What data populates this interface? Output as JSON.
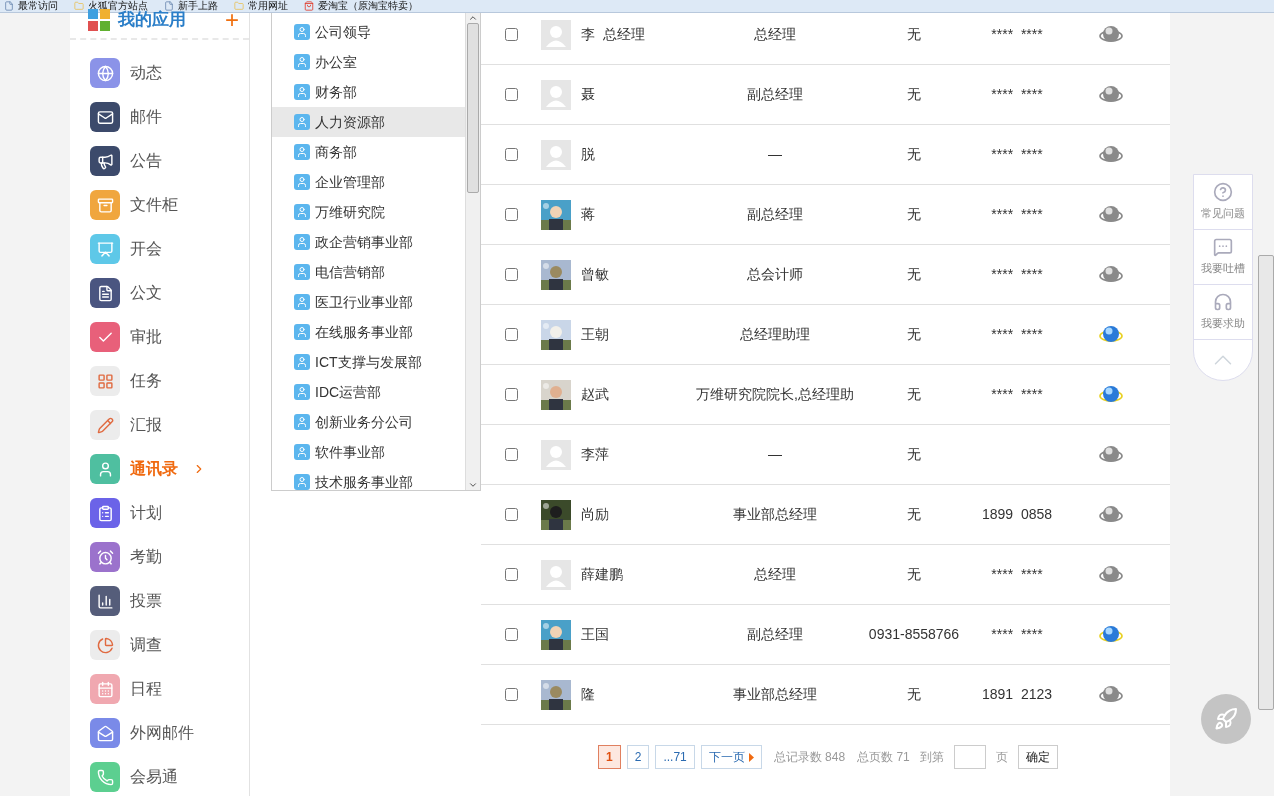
{
  "bookmarks": [
    {
      "label": "最常访问",
      "kind": "page"
    },
    {
      "label": "火狐官方站点",
      "kind": "folder"
    },
    {
      "label": "新手上路",
      "kind": "page"
    },
    {
      "label": "常用网址",
      "kind": "folder"
    },
    {
      "label": "爱淘宝（原淘宝特卖）",
      "kind": "shop"
    }
  ],
  "sidebar": {
    "title": "我的应用",
    "add": "+",
    "items": [
      {
        "label": "动态",
        "color": "#8b93e8",
        "selected": false
      },
      {
        "label": "邮件",
        "color": "#3c4a6b",
        "selected": false
      },
      {
        "label": "公告",
        "color": "#3c4a6b",
        "selected": false
      },
      {
        "label": "文件柜",
        "color": "#f0a63e",
        "selected": false
      },
      {
        "label": "开会",
        "color": "#5ec8e8",
        "selected": false
      },
      {
        "label": "公文",
        "color": "#4a5580",
        "selected": false
      },
      {
        "label": "审批",
        "color": "#e8607a",
        "selected": false
      },
      {
        "label": "任务",
        "color": "#ececec",
        "selected": false
      },
      {
        "label": "汇报",
        "color": "#ececec",
        "selected": false
      },
      {
        "label": "通讯录",
        "color": "#4fbfa0",
        "selected": true
      },
      {
        "label": "计划",
        "color": "#6b63e8",
        "selected": false
      },
      {
        "label": "考勤",
        "color": "#9b72cc",
        "selected": false
      },
      {
        "label": "投票",
        "color": "#555d7a",
        "selected": false
      },
      {
        "label": "调查",
        "color": "#ececec",
        "selected": false
      },
      {
        "label": "日程",
        "color": "#f0a8b0",
        "selected": false
      },
      {
        "label": "外网邮件",
        "color": "#7a8ae8",
        "selected": false
      },
      {
        "label": "会易通",
        "color": "#5ccf90",
        "selected": false
      }
    ]
  },
  "departments": [
    {
      "label": "公司领导",
      "selected": false
    },
    {
      "label": "办公室",
      "selected": false
    },
    {
      "label": "财务部",
      "selected": false
    },
    {
      "label": "人力资源部",
      "selected": true
    },
    {
      "label": "商务部",
      "selected": false
    },
    {
      "label": "企业管理部",
      "selected": false
    },
    {
      "label": "万维研究院",
      "selected": false
    },
    {
      "label": "政企营销事业部",
      "selected": false
    },
    {
      "label": "电信营销部",
      "selected": false
    },
    {
      "label": "医卫行业事业部",
      "selected": false
    },
    {
      "label": "在线服务事业部",
      "selected": false
    },
    {
      "label": "ICT支撑与发展部",
      "selected": false
    },
    {
      "label": "IDC运营部",
      "selected": false
    },
    {
      "label": "创新业务分公司",
      "selected": false
    },
    {
      "label": "软件事业部",
      "selected": false
    },
    {
      "label": "技术服务事业部",
      "selected": false
    }
  ],
  "contacts": [
    {
      "checked": false,
      "kind": "placeholder",
      "name": "李  总经理",
      "title": "总经理",
      "office_phone": "无",
      "mobile": "****  ****",
      "online": false
    },
    {
      "checked": false,
      "kind": "placeholder",
      "name": "聂",
      "title": "副总经理",
      "office_phone": "无",
      "mobile": "****  ****",
      "online": false
    },
    {
      "checked": false,
      "kind": "placeholder",
      "name": "脱",
      "title": "—",
      "office_phone": "无",
      "mobile": "****  ****",
      "online": false
    },
    {
      "checked": false,
      "name": "蒋",
      "title": "副总经理",
      "office_phone": "无",
      "mobile": "****  ****",
      "online": false
    },
    {
      "checked": false,
      "name": "曾敏",
      "title": "总会计师",
      "office_phone": "无",
      "mobile": "****  ****",
      "online": false
    },
    {
      "checked": false,
      "name": "王朝",
      "title": "总经理助理",
      "office_phone": "无",
      "mobile": "****  ****",
      "online": true
    },
    {
      "checked": false,
      "name": "赵武",
      "title": "万维研究院院长,总经理助",
      "office_phone": "无",
      "mobile": "****  ****",
      "online": true
    },
    {
      "checked": false,
      "kind": "placeholder",
      "name": "李萍",
      "title": "—",
      "office_phone": "无",
      "online": false
    },
    {
      "checked": false,
      "name": "尚励",
      "title": "事业部总经理",
      "office_phone": "无",
      "mobile": "1899  0858",
      "online": false
    },
    {
      "checked": false,
      "kind": "placeholder",
      "name": "薛建鹏",
      "title": "总经理",
      "office_phone": "无",
      "mobile": "****  ****",
      "online": false
    },
    {
      "checked": false,
      "name": "王国",
      "title": "副总经理",
      "office_phone": "0931-8558766",
      "mobile": "****  ****",
      "online": true
    },
    {
      "checked": false,
      "name": "隆",
      "title": "事业部总经理",
      "office_phone": "无",
      "mobile": "1891  2123",
      "online": false
    }
  ],
  "pagination": {
    "pages": [
      {
        "label": "1",
        "selected": true
      },
      {
        "label": "2",
        "selected": false
      },
      {
        "label": "...71",
        "selected": false
      }
    ],
    "next": "下一页",
    "total_records": "总记录数 848",
    "total_pages": "总页数 71",
    "goto": "到第",
    "page_unit": "页",
    "confirm": "确定"
  },
  "help_panel": [
    {
      "label": "常见问题",
      "kind": "faq"
    },
    {
      "label": "我要吐槽",
      "kind": "feedback"
    },
    {
      "label": "我要求助",
      "kind": "support"
    }
  ]
}
